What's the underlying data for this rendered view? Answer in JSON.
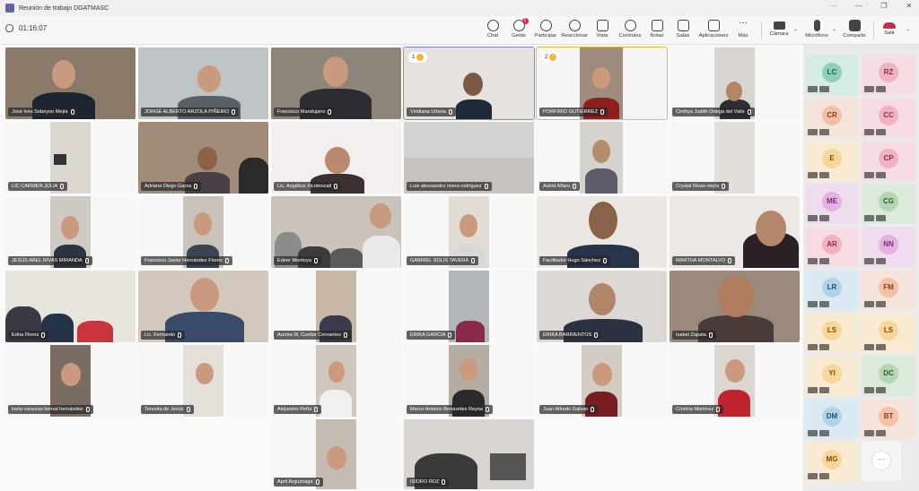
{
  "window": {
    "title": "Reunión de trabajo DGATMASC",
    "controls": [
      "···",
      "—",
      "❐",
      "✕"
    ]
  },
  "meeting": {
    "timer": "01:16:07"
  },
  "toolbar": {
    "chat": "Chat",
    "people": "Gente",
    "people_badge": "2",
    "raise_hand": "Participar",
    "react": "Reaccionar",
    "view": "Vista",
    "controls": "Controles",
    "notes": "Notas",
    "rooms": "Salas",
    "apps": "Aplicaciones",
    "more": "Más",
    "camera": "Cámara",
    "mic": "Micrófono",
    "share": "Comparte",
    "leave": "Salir"
  },
  "participants": [
    "José Ives Sobeyon Mejía",
    "JORGE ALBERTO ARZOLA PIÑEIRO",
    "Francisco Mandujano",
    "Viridiana Urbina",
    "PORFIRIO GUTIÉRREZ",
    "Cinthya Judith Ortega del Valle",
    "LIC CARMEN JULIA",
    "Adriana Diego Garza",
    "Lic. Angélica Xicotencatl",
    "Luis alessandro rivera rodriguez",
    "Astrid Alfaro",
    "Crystal Rivas mejía",
    "JESÚS ABEL RIVAS MIRANDA",
    "Francisco Javier Hernández Flores",
    "Edeer Montoya",
    "GABRIEL SOLIS TAVERA",
    "Facilitador Hugo Sánchez",
    "MARTHA MONTALVO",
    "Edna Flores",
    "Lic. Fernando",
    "Aurora M. Cuellar Cervantes",
    "ERIKA GARCIA",
    "ERIKA BARRIENTOS",
    "Isabel Zapata",
    "karla vanessa bernal hernández",
    "Teresita de Jesús",
    "Alejandro Peña",
    "Marco Antonio Benavides Reyna",
    "Juan Alfredo Galvan",
    "Cristina Martínez",
    "April Arguznaga",
    "ISIDRO RDZ"
  ],
  "hand_raised": {
    "viridiana": "1",
    "porfirio": "2"
  },
  "side_participants": [
    "LC",
    "RZ",
    "CR",
    "CC",
    "E",
    "CP",
    "ME",
    "CG",
    "AR",
    "NN",
    "LR",
    "FM",
    "LS",
    "LS",
    "YI",
    "DC",
    "DM",
    "BT",
    "MG"
  ],
  "more_label": "···",
  "colors": {
    "accent": "#6264a7",
    "leave": "#c4314b",
    "hand": "#f2b93b"
  }
}
